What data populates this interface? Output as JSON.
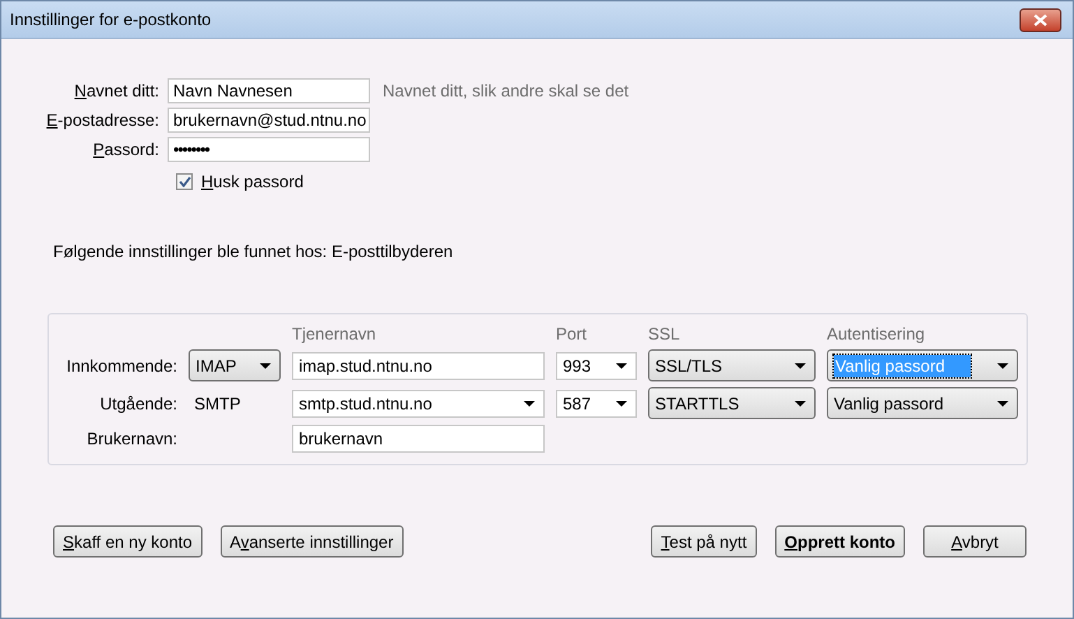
{
  "window": {
    "title": "Innstillinger for e-postkonto"
  },
  "fields": [
    {
      "kind": "text",
      "label": {
        "key": "N",
        "after": "avnet ditt:"
      },
      "value": "Navn Navnesen",
      "hint": "Navnet ditt, slik andre skal se det"
    },
    {
      "kind": "text",
      "label": {
        "key": "E",
        "after": "-postadresse:"
      },
      "value": "brukernavn@stud.ntnu.no"
    },
    {
      "kind": "password",
      "label": {
        "key": "P",
        "after": "assord:"
      },
      "value": "••••••••"
    }
  ],
  "remember": {
    "label": {
      "key": "H",
      "after": "usk passord"
    },
    "checked": true
  },
  "notice": "Følgende innstillinger ble funnet hos: E-posttilbyderen",
  "server": {
    "columns": [
      "Tjenernavn",
      "Port",
      "SSL",
      "Autentisering"
    ],
    "rows": [
      {
        "label": "Innkommende:",
        "protocol": {
          "kind": "select",
          "value": "IMAP"
        },
        "host": {
          "kind": "text",
          "value": "imap.stud.ntnu.no"
        },
        "port": "993",
        "ssl": "SSL/TLS",
        "auth": {
          "value": "Vanlig passord",
          "selected": true
        }
      },
      {
        "label": "Utgående:",
        "protocol": {
          "kind": "plain",
          "value": "SMTP"
        },
        "host": {
          "kind": "combo",
          "value": "smtp.stud.ntnu.no"
        },
        "port": "587",
        "ssl": "STARTTLS",
        "auth": {
          "value": "Vanlig passord",
          "selected": false
        }
      }
    ],
    "username": {
      "label": "Brukernavn:",
      "value": "brukernavn"
    }
  },
  "buttons_left": [
    {
      "label": {
        "key": "S",
        "after": "kaff en ny konto"
      },
      "default": false
    },
    {
      "label": {
        "before": "A",
        "key": "v",
        "after": "anserte innstillinger"
      },
      "default": false
    }
  ],
  "buttons_right": [
    {
      "label": {
        "key": "T",
        "after": "est på nytt"
      },
      "default": false
    },
    {
      "label": {
        "key": "O",
        "after": "pprett konto"
      },
      "default": true
    },
    {
      "label": {
        "key": "A",
        "after": "vbryt"
      },
      "default": false
    }
  ]
}
